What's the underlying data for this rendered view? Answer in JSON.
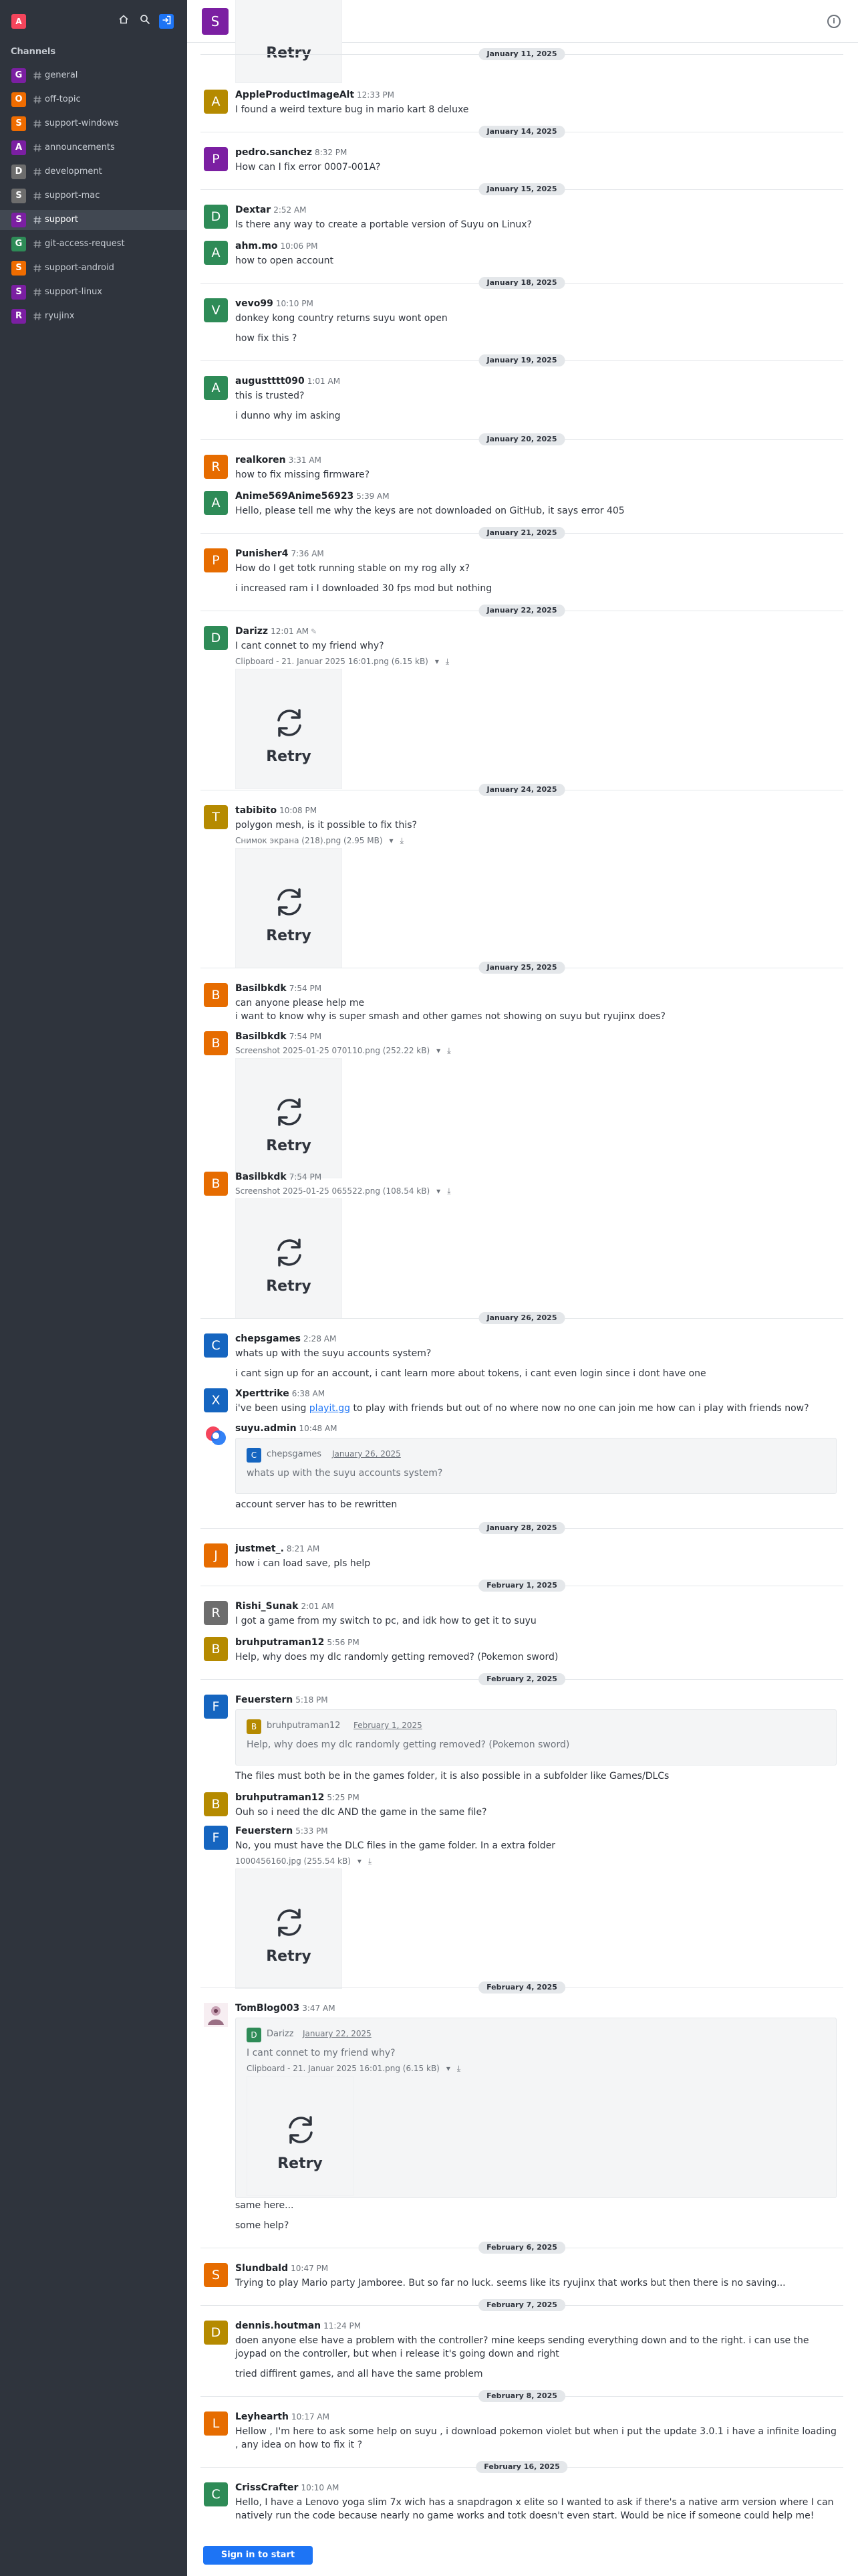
{
  "sidebar": {
    "user_avatar": "A",
    "tools": {
      "home_icon": "home-icon",
      "search_icon": "search-icon",
      "login_icon": "login-icon"
    },
    "section_title": "Channels",
    "channels": [
      {
        "name": "general",
        "letter": "G",
        "color": "#7b1fa2"
      },
      {
        "name": "off-topic",
        "letter": "O",
        "color": "#ef6c00"
      },
      {
        "name": "support-windows",
        "letter": "S",
        "color": "#ef6c00"
      },
      {
        "name": "announcements",
        "letter": "A",
        "color": "#7b1fa2"
      },
      {
        "name": "development",
        "letter": "D",
        "color": "#6d6d6d"
      },
      {
        "name": "support-mac",
        "letter": "S",
        "color": "#6d6d6d"
      },
      {
        "name": "support",
        "letter": "S",
        "color": "#7b1fa2",
        "selected": true
      },
      {
        "name": "git-access-request",
        "letter": "G",
        "color": "#2e8b57"
      },
      {
        "name": "support-android",
        "letter": "S",
        "color": "#ef6c00"
      },
      {
        "name": "support-linux",
        "letter": "S",
        "color": "#7b1fa2"
      },
      {
        "name": "ryujinx",
        "letter": "R",
        "color": "#7b1fa2"
      }
    ]
  },
  "header": {
    "avatar": "S",
    "title": "support",
    "info_icon": "info-icon"
  },
  "retry_label": "Retry",
  "dates": [
    "January 11, 2025",
    "January 14, 2025",
    "January 15, 2025",
    "January 18, 2025",
    "January 19, 2025",
    "January 20, 2025",
    "January 21, 2025",
    "January 22, 2025",
    "January 24, 2025",
    "January 25, 2025",
    "January 26, 2025",
    "January 28, 2025",
    "February 1, 2025",
    "February 2, 2025",
    "February 4, 2025",
    "February 6, 2025",
    "February 7, 2025",
    "February 8, 2025",
    "February 16, 2025"
  ],
  "messages": [
    {
      "user": "AppleProductImageAlt",
      "avatar": "A",
      "color": "#b58a00",
      "time": "12:33 PM",
      "text": "I found a weird texture bug in mario kart 8 deluxe"
    },
    {
      "user": "pedro.sanchez",
      "avatar": "P",
      "color": "#7b1fa2",
      "time": "8:32 PM",
      "text": "How can I fix error 0007-001A?"
    },
    {
      "user": "Dextar",
      "avatar": "D",
      "color": "#2e8b57",
      "time": "2:52 AM",
      "text": "Is there any way to create a portable version of Suyu on Linux?"
    },
    {
      "user": "ahm.mo",
      "avatar": "A",
      "color": "#2e8b57",
      "time": "10:06 PM",
      "text": "how to open account"
    },
    {
      "user": "vevo99",
      "avatar": "V",
      "color": "#2e8b57",
      "time": "10:10 PM",
      "text": "donkey kong country returns suyu wont open",
      "text2": "how fix this ?"
    },
    {
      "user": "augustttt090",
      "avatar": "A",
      "color": "#2e8b57",
      "time": "1:01 AM",
      "text": "this is trusted?",
      "text2": "i dunno why im asking"
    },
    {
      "user": "realkoren",
      "avatar": "R",
      "color": "#e66c00",
      "time": "3:31 AM",
      "text": "how to fix missing firmware?"
    },
    {
      "user": "Anime569Anime56923",
      "avatar": "A",
      "color": "#2e8b57",
      "time": "5:39 AM",
      "text": "Hello, please tell me why the keys are not downloaded on GitHub, it says error 405"
    },
    {
      "user": "Punisher4",
      "avatar": "P",
      "color": "#e66c00",
      "time": "7:36 AM",
      "text": "How do I get totk running stable on my rog ally x?",
      "text2": "i increased ram i I downloaded 30 fps mod but nothing"
    },
    {
      "user": "Darizz",
      "avatar": "D",
      "color": "#2e8b57",
      "time": "12:01 AM",
      "edit_icon": "pencil-icon",
      "text": "I cant connet to my friend why?",
      "attachment": "Clipboard - 21. Januar 2025 16:01.png (6.15 kB)"
    },
    {
      "user": "tabibito",
      "avatar": "T",
      "color": "#b58a00",
      "time": "10:08 PM",
      "text": "polygon mesh, is it possible to fix this?",
      "attachment": "Снимок экрана (218).png (2.95 MB)"
    },
    {
      "user": "Basilbkdk",
      "avatar": "B",
      "color": "#e66c00",
      "time": "7:54 PM",
      "text": "can anyone please help me",
      "text2": "i want to know why is super smash and other games not showing on suyu but ryujinx does?"
    },
    {
      "user": "Basilbkdk",
      "avatar": "B",
      "color": "#e66c00",
      "time": "7:54 PM",
      "attachment": "Screenshot 2025-01-25 070110.png (252.22 kB)"
    },
    {
      "user": "Basilbkdk",
      "avatar": "B",
      "color": "#e66c00",
      "time": "7:54 PM",
      "attachment": "Screenshot 2025-01-25 065522.png (108.54 kB)"
    },
    {
      "user": "chepsgames",
      "avatar": "C",
      "color": "#1565c0",
      "time": "2:28 AM",
      "text": "whats up with the suyu accounts system?",
      "text2": "i cant sign up for an account, i cant learn more about tokens, i cant even login since i dont have one"
    },
    {
      "user": "Xperttrike",
      "avatar": "X",
      "color": "#1565c0",
      "time": "6:38 AM",
      "text_before": "i've been using ",
      "link": "playit.gg",
      "text_after": " to play with friends but out of no where now no one can join me how can i play with friends now?"
    },
    {
      "user": "suyu.admin",
      "avatar": "",
      "time": "10:48 AM",
      "quote": {
        "avatar": "C",
        "color": "#1565c0",
        "user": "chepsgames",
        "date": "January 26, 2025",
        "text": "whats up with the suyu accounts system?"
      },
      "text": "account server has to be rewritten"
    },
    {
      "user": "justmet_.",
      "avatar": "J",
      "color": "#e66c00",
      "time": "8:21 AM",
      "text": "how i can load save, pls help"
    },
    {
      "user": "Rishi_Sunak",
      "avatar": "R",
      "color": "#6d6d6d",
      "time": "2:01 AM",
      "text": "I got a game from my switch to pc, and idk how to get it to suyu"
    },
    {
      "user": "bruhputraman12",
      "avatar": "B",
      "color": "#b58a00",
      "time": "5:56 PM",
      "text": "Help, why does my dlc randomly getting removed? (Pokemon sword)"
    },
    {
      "user": "Feuerstern",
      "avatar": "F",
      "color": "#1565c0",
      "time": "5:18 PM",
      "quote": {
        "avatar": "B",
        "color": "#b58a00",
        "user": "bruhputraman12",
        "date": "February 1, 2025",
        "text": "Help, why does my dlc randomly getting removed? (Pokemon sword)"
      },
      "text": "The files must both be in the games folder, it is also possible in a subfolder like Games/DLCs"
    },
    {
      "user": "bruhputraman12",
      "avatar": "B",
      "color": "#b58a00",
      "time": "5:25 PM",
      "text": "Ouh so i need the dlc AND the game in the same file?"
    },
    {
      "user": "Feuerstern",
      "avatar": "F",
      "color": "#1565c0",
      "time": "5:33 PM",
      "text": "No, you must have the DLC files in the game folder. In a extra folder",
      "attachment": "1000456160.jpg (255.54 kB)"
    },
    {
      "user": "TomBlog003",
      "avatar": "",
      "time": "3:47 AM",
      "quote": {
        "avatar": "D",
        "color": "#2e8b57",
        "user": "Darizz",
        "date": "January 22, 2025",
        "text": "I cant connet to my friend why?",
        "attachment": "Clipboard - 21. Januar 2025 16:01.png (6.15 kB)"
      },
      "text": "same here...",
      "text2": "some help?"
    },
    {
      "user": "Slundbald",
      "avatar": "S",
      "color": "#e66c00",
      "time": "10:47 PM",
      "text": "Trying to play Mario party Jamboree. But so far no luck. seems like its ryujinx that works but then there is no saving..."
    },
    {
      "user": "dennis.houtman",
      "avatar": "D",
      "color": "#b58a00",
      "time": "11:24 PM",
      "text": "doen anyone else have a problem with the controller? mine keeps sending everything down and to the right. i can use the joypad on the controller, but when i release it's going down and right",
      "text2": "tried diffirent games, and all have the same problem"
    },
    {
      "user": "Leyhearth",
      "avatar": "L",
      "color": "#e66c00",
      "time": "10:17 AM",
      "text": "Hellow , I'm here to ask some help on suyu , i download pokemon violet but when i put the update 3.0.1 i have a infinite loading , any idea on how to fix it ?"
    },
    {
      "user": "CrissCrafter",
      "avatar": "C",
      "color": "#2e8b57",
      "time": "10:10 AM",
      "text": "Hello, I have a Lenovo yoga slim 7x wich has a snapdragon x elite so I wanted to ask if there's a native arm version where I can natively run the code because nearly no game works and totk doesn't even start. Would be nice if someone could help me!"
    }
  ],
  "footer": {
    "signin_label": "Sign in to start talking"
  }
}
